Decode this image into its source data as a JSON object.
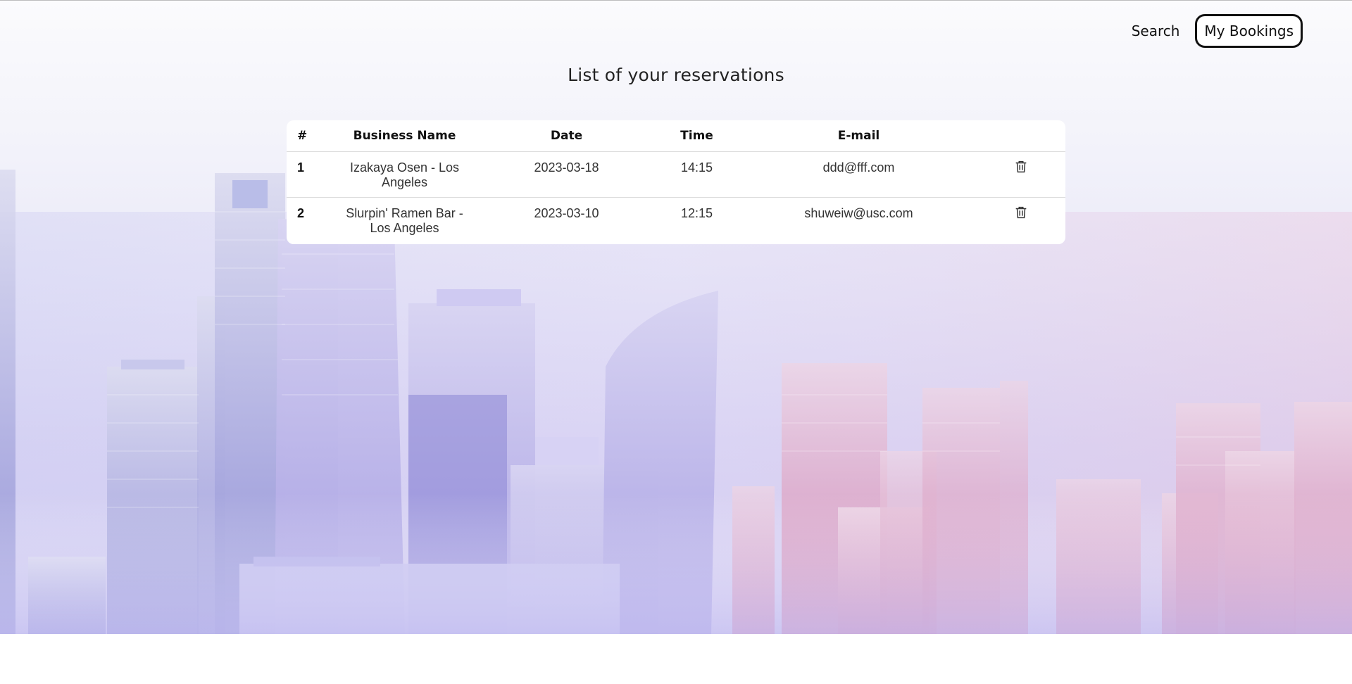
{
  "nav": {
    "search_label": "Search",
    "bookings_label": "My Bookings"
  },
  "page": {
    "title": "List of your reservations"
  },
  "table": {
    "headers": {
      "num": "#",
      "business": "Business Name",
      "date": "Date",
      "time": "Time",
      "email": "E-mail"
    },
    "rows": [
      {
        "num": "1",
        "business": "Izakaya Osen - Los Angeles",
        "date": "2023-03-18",
        "time": "14:15",
        "email": "ddd@fff.com",
        "action_icon": "trash-icon"
      },
      {
        "num": "2",
        "business": "Slurpin' Ramen Bar - Los Angeles",
        "date": "2023-03-10",
        "time": "12:15",
        "email": "shuweiw@usc.com",
        "action_icon": "trash-icon"
      }
    ]
  },
  "colors": {
    "accent_purple": "#9b93e6",
    "accent_pink": "#d67aa6",
    "text_dark": "#111111"
  }
}
